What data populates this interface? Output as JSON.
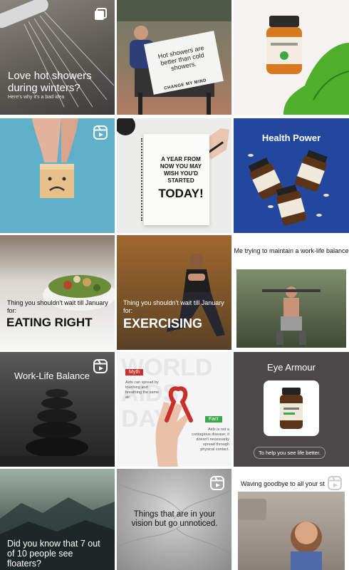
{
  "tiles": [
    {
      "id": "t1",
      "head": "Love hot showers during winters?",
      "sub": "Here's why it's a bad idea",
      "badge": "carousel-icon"
    },
    {
      "id": "t2",
      "sign_text": "Hot showers are better than cold showers.",
      "sign_bottom": "CHANGE MY MIND"
    },
    {
      "id": "t3"
    },
    {
      "id": "t4",
      "badge": "reel-icon"
    },
    {
      "id": "t5",
      "lead": "A YEAR FROM NOW YOU MAY WISH YOU'D STARTED",
      "big": "TODAY!"
    },
    {
      "id": "t6",
      "title": "Health Power"
    },
    {
      "id": "t7",
      "pre": "Thing you shouldn't wait till January for:",
      "big": "EATING RIGHT"
    },
    {
      "id": "t8",
      "pre": "Thing you shouldn't wait till January for:",
      "big": "EXERCISING"
    },
    {
      "id": "t9",
      "cap": "Me trying to maintain a work-life balance"
    },
    {
      "id": "t10",
      "title": "Work-Life Balance",
      "badge": "reel-icon"
    },
    {
      "id": "t11",
      "bg_word": "WORLD AIDS DAY",
      "myth_tag": "Myth",
      "myth_text": "Aids can spread by touching and breathing the same air.",
      "fact_tag": "Fact",
      "fact_text": "Aids is not a contagious disease; it doesn't necessarily spread through physical contact."
    },
    {
      "id": "t12",
      "title": "Eye Armour",
      "pill": "To help you see life better."
    },
    {
      "id": "t13",
      "head": "Did you know that 7 out of 10 people see floaters?"
    },
    {
      "id": "t14",
      "head": "Things that are in your vision but go unnoticed.",
      "badge": "reel-icon"
    },
    {
      "id": "t15",
      "cap": "Waving goodbye to all your st",
      "badge": "reel-icon"
    }
  ],
  "colors": {
    "myth": "#c8302b",
    "fact": "#3aa74a",
    "blue": "#23479e"
  }
}
